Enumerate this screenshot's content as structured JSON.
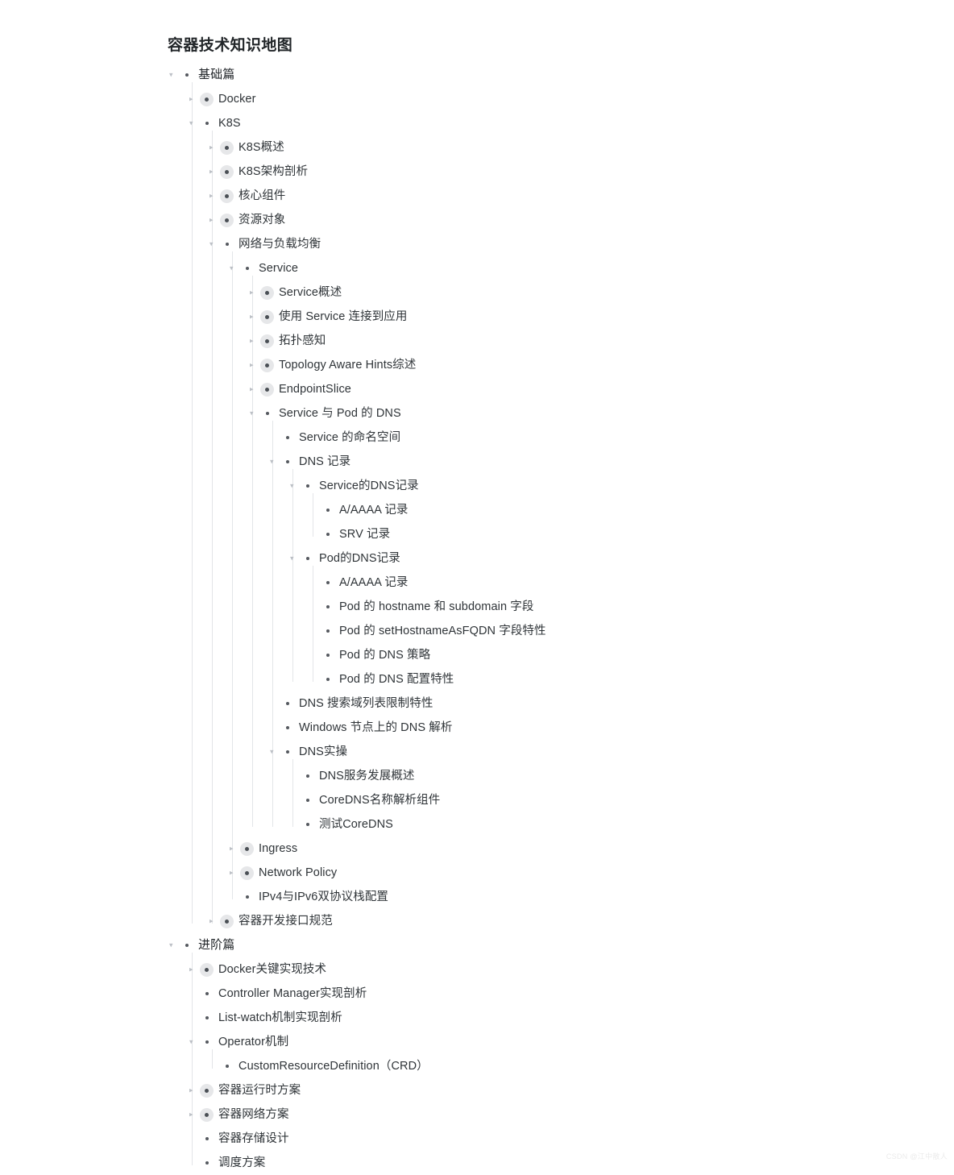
{
  "page": {
    "title": "容器技术知识地图",
    "watermark": "CSDN @江中散人",
    "colors": {
      "text": "#2f3438",
      "title": "#22262a",
      "bullet": "#4a4f55",
      "bullet_ring": "#e6e7e9",
      "guide_line": "#e3e5e8",
      "arrow": "#bcc0c6",
      "background": "#ffffff"
    },
    "icons": {
      "collapsed": "chevron-right-icon",
      "expanded": "chevron-down-icon",
      "bullet": "bullet-dot-icon"
    }
  },
  "tree": [
    {
      "label": "基础篇",
      "state": "expanded",
      "children": [
        {
          "label": "Docker",
          "state": "collapsed",
          "children": []
        },
        {
          "label": "K8S",
          "state": "expanded",
          "children": [
            {
              "label": "K8S概述",
              "state": "collapsed",
              "children": []
            },
            {
              "label": "K8S架构剖析",
              "state": "collapsed",
              "children": []
            },
            {
              "label": "核心组件",
              "state": "collapsed",
              "children": []
            },
            {
              "label": "资源对象",
              "state": "collapsed",
              "children": []
            },
            {
              "label": "网络与负载均衡",
              "state": "expanded",
              "children": [
                {
                  "label": "Service",
                  "state": "expanded",
                  "children": [
                    {
                      "label": "Service概述",
                      "state": "collapsed",
                      "children": []
                    },
                    {
                      "label": "使用 Service 连接到应用",
                      "state": "collapsed",
                      "children": []
                    },
                    {
                      "label": "拓扑感知",
                      "state": "collapsed",
                      "children": []
                    },
                    {
                      "label": "Topology Aware Hints综述",
                      "state": "collapsed",
                      "children": []
                    },
                    {
                      "label": "EndpointSlice",
                      "state": "collapsed",
                      "children": []
                    },
                    {
                      "label": "Service 与 Pod 的 DNS",
                      "state": "expanded",
                      "children": [
                        {
                          "label": "Service 的命名空间",
                          "state": "leaf",
                          "children": []
                        },
                        {
                          "label": "DNS 记录",
                          "state": "expanded",
                          "children": [
                            {
                              "label": "Service的DNS记录",
                              "state": "expanded",
                              "children": [
                                {
                                  "label": "A/AAAA 记录",
                                  "state": "leaf",
                                  "children": []
                                },
                                {
                                  "label": "SRV 记录",
                                  "state": "leaf",
                                  "children": []
                                }
                              ]
                            },
                            {
                              "label": "Pod的DNS记录",
                              "state": "expanded",
                              "children": [
                                {
                                  "label": "A/AAAA 记录",
                                  "state": "leaf",
                                  "children": []
                                },
                                {
                                  "label": "Pod 的 hostname 和 subdomain 字段",
                                  "state": "leaf",
                                  "children": []
                                },
                                {
                                  "label": "Pod 的 setHostnameAsFQDN 字段特性",
                                  "state": "leaf",
                                  "children": []
                                },
                                {
                                  "label": "Pod 的 DNS 策略",
                                  "state": "leaf",
                                  "children": []
                                },
                                {
                                  "label": "Pod 的 DNS 配置特性",
                                  "state": "leaf",
                                  "children": []
                                }
                              ]
                            }
                          ]
                        },
                        {
                          "label": "DNS 搜索域列表限制特性",
                          "state": "leaf",
                          "children": []
                        },
                        {
                          "label": "Windows 节点上的 DNS 解析",
                          "state": "leaf",
                          "children": []
                        },
                        {
                          "label": "DNS实操",
                          "state": "expanded",
                          "children": [
                            {
                              "label": "DNS服务发展概述",
                              "state": "leaf",
                              "children": []
                            },
                            {
                              "label": "CoreDNS名称解析组件",
                              "state": "leaf",
                              "children": []
                            },
                            {
                              "label": "测试CoreDNS",
                              "state": "leaf",
                              "children": []
                            }
                          ]
                        }
                      ]
                    }
                  ]
                },
                {
                  "label": "Ingress",
                  "state": "collapsed",
                  "children": []
                },
                {
                  "label": "Network Policy",
                  "state": "collapsed",
                  "children": []
                },
                {
                  "label": "IPv4与IPv6双协议栈配置",
                  "state": "leaf",
                  "children": []
                }
              ]
            },
            {
              "label": "容器开发接口规范",
              "state": "collapsed",
              "children": []
            }
          ]
        }
      ]
    },
    {
      "label": "进阶篇",
      "state": "expanded",
      "children": [
        {
          "label": "Docker关键实现技术",
          "state": "collapsed",
          "children": []
        },
        {
          "label": "Controller Manager实现剖析",
          "state": "leaf",
          "children": []
        },
        {
          "label": "List-watch机制实现剖析",
          "state": "leaf",
          "children": []
        },
        {
          "label": "Operator机制",
          "state": "expanded",
          "children": [
            {
              "label": "CustomResourceDefinition（CRD）",
              "state": "leaf",
              "children": []
            }
          ]
        },
        {
          "label": "容器运行时方案",
          "state": "collapsed",
          "children": []
        },
        {
          "label": "容器网络方案",
          "state": "collapsed",
          "children": []
        },
        {
          "label": "容器存储设计",
          "state": "leaf",
          "children": []
        },
        {
          "label": "调度方案",
          "state": "leaf",
          "children": []
        }
      ]
    }
  ]
}
